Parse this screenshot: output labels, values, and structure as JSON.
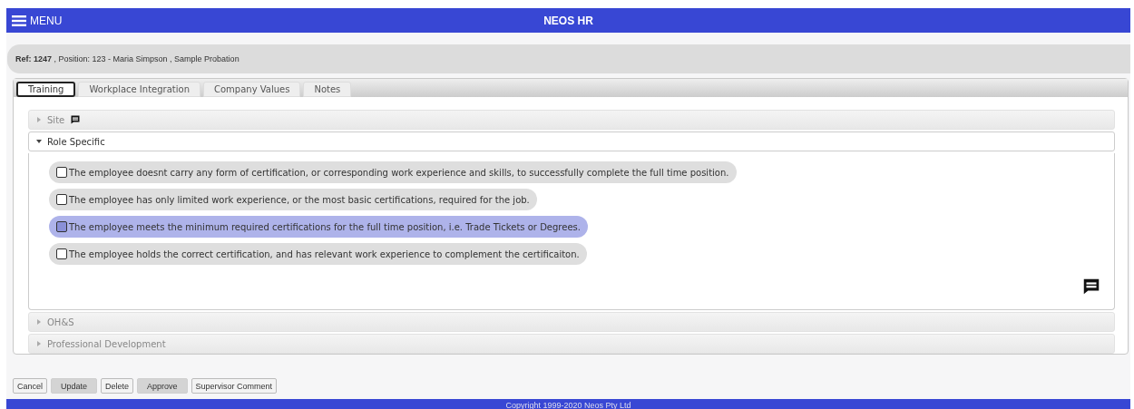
{
  "header": {
    "menu_label": "MENU",
    "title": "NEOS HR"
  },
  "record": {
    "ref_label": "Ref: 1247",
    "details": " , Position: 123 - Maria Simpson , Sample Probation"
  },
  "tabs": [
    {
      "label": "Training",
      "selected": true
    },
    {
      "label": "Workplace Integration",
      "selected": false
    },
    {
      "label": "Company Values",
      "selected": false
    },
    {
      "label": "Notes",
      "selected": false
    }
  ],
  "sections": [
    {
      "title": "Site",
      "expanded": false,
      "has_comment": true
    },
    {
      "title": "Role Specific",
      "expanded": true,
      "has_comment": false,
      "options": [
        {
          "text": "The employee doesnt carry any form of certification, or corresponding work experience and skills, to successfully complete the full time position.",
          "selected": false,
          "checked": false
        },
        {
          "text": "The employee has only limited work experience, or the most basic certifications, required for the job.",
          "selected": false,
          "checked": false
        },
        {
          "text": "The employee meets the minimum required certifications for the full time position, i.e. Trade Tickets or Degrees.",
          "selected": true,
          "checked": false
        },
        {
          "text": "The employee holds the correct certification, and has relevant work experience to complement the certificaiton.",
          "selected": false,
          "checked": false
        }
      ]
    },
    {
      "title": "OH&S",
      "expanded": false,
      "has_comment": false
    },
    {
      "title": "Professional Development",
      "expanded": false,
      "has_comment": false
    }
  ],
  "buttons": [
    {
      "label": "Cancel",
      "disabled": false
    },
    {
      "label": "Update",
      "disabled": true
    },
    {
      "label": "Delete",
      "disabled": false
    },
    {
      "label": "Approve",
      "disabled": true
    },
    {
      "label": "Supervisor Comment",
      "disabled": false
    }
  ],
  "footer": {
    "text": "Copyright 1999-2020 Neos Pty Ltd"
  }
}
